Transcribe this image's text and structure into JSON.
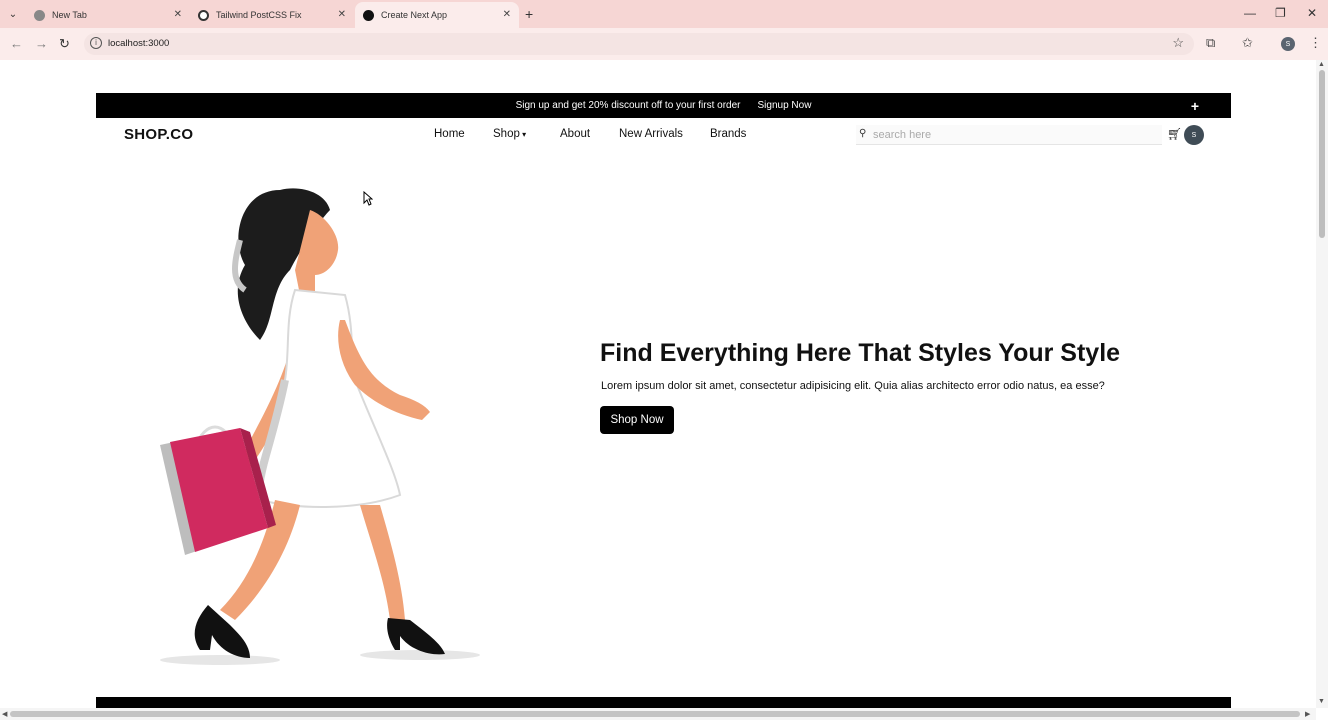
{
  "browser": {
    "tabs": [
      {
        "title": "New Tab",
        "icon": "chrome-icon"
      },
      {
        "title": "Tailwind PostCSS Fix",
        "icon": "openai-icon"
      },
      {
        "title": "Create Next App",
        "icon": "nextjs-icon"
      }
    ],
    "url": "localhost:3000",
    "profile_initial": "S"
  },
  "promo": {
    "text": "Sign up and get 20% discount off to your first order",
    "link": "Signup Now",
    "plus": "+"
  },
  "header": {
    "logo": "SHOP.CO",
    "nav": {
      "home": "Home",
      "shop": "Shop",
      "about": "About",
      "new_arrivals": "New Arrivals",
      "brands": "Brands"
    },
    "search_placeholder": "search here",
    "avatar_initial": "S"
  },
  "hero": {
    "headline": "Find Everything Here That Styles Your Style",
    "subtext": "Lorem ipsum dolor sit amet, consectetur adipisicing elit. Quia alias architecto error odio natus, ea esse?",
    "button": "Shop Now"
  },
  "colors": {
    "tabbar": "#f6d6d4",
    "toolbar": "#fbeceb",
    "promo_bg": "#000000",
    "bag": "#d02a5f",
    "skin": "#f0a277"
  }
}
